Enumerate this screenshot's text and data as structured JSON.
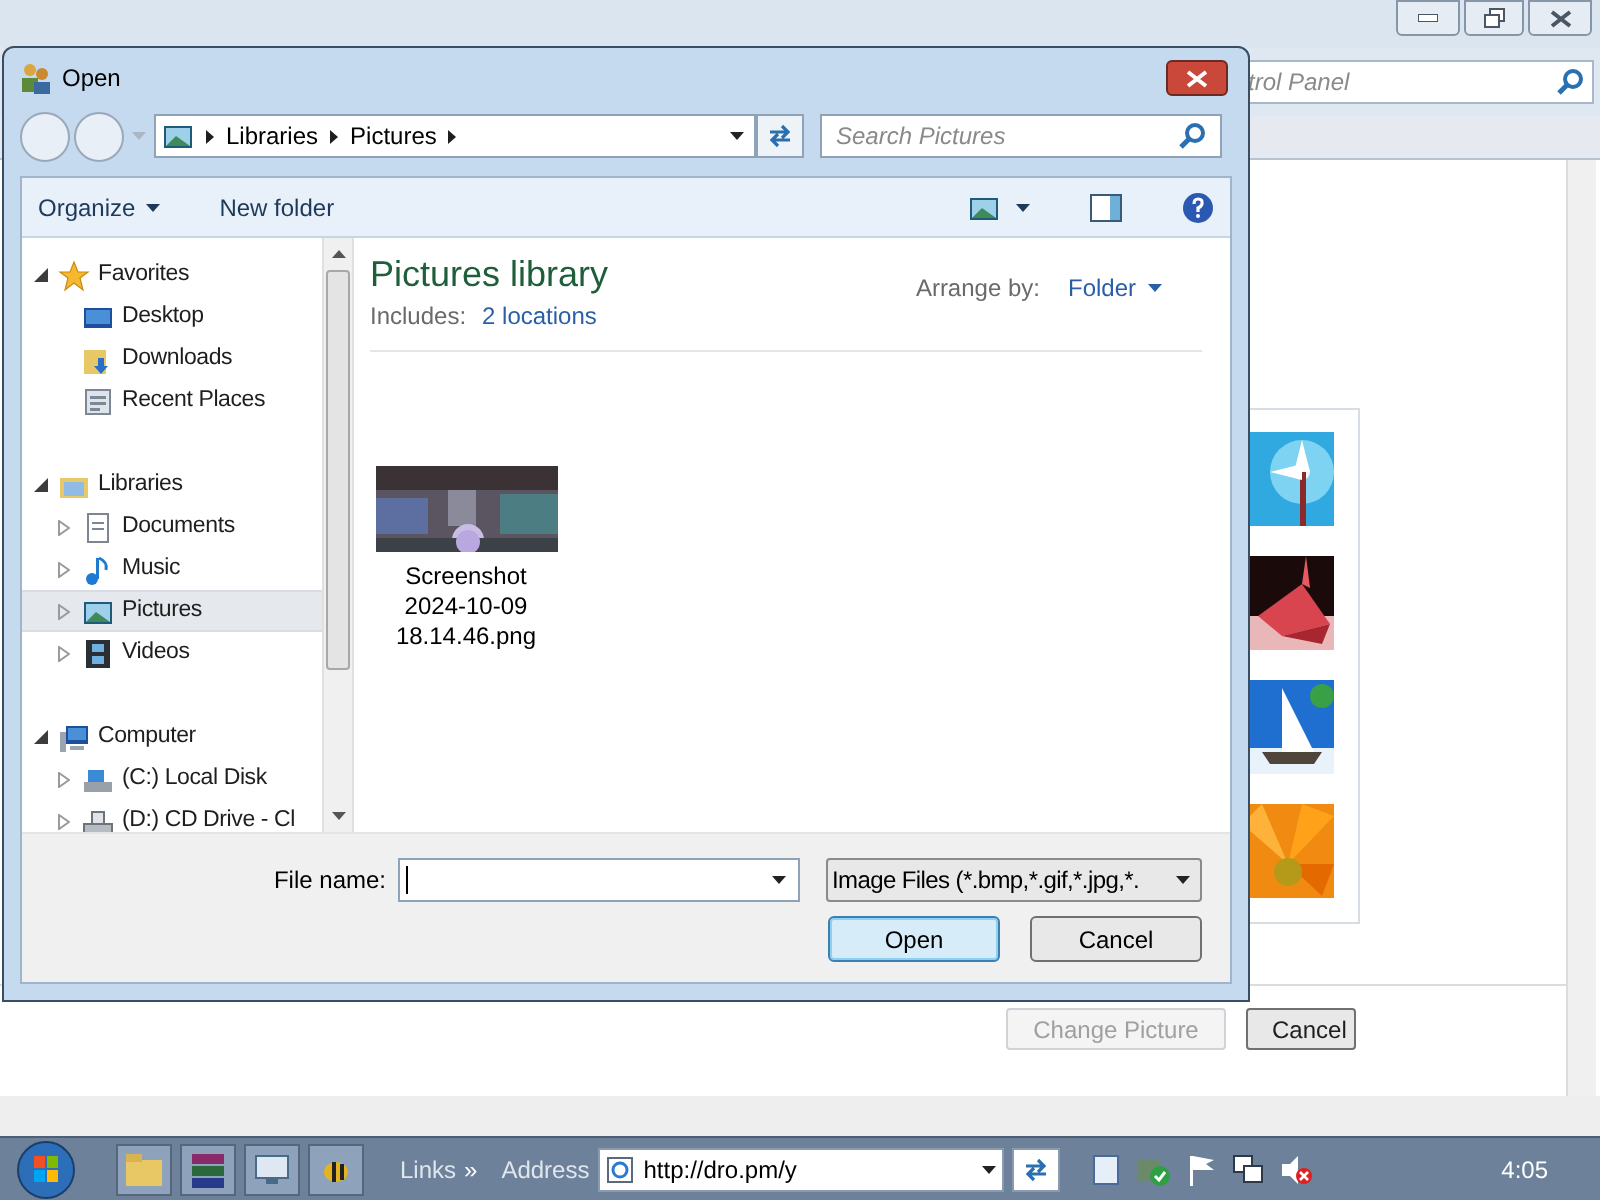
{
  "background_window": {
    "search": {
      "placeholder": "trol Panel"
    },
    "buttons": [
      {
        "label": "Change Picture",
        "disabled": true
      },
      {
        "label": "Cancel",
        "disabled": false
      }
    ]
  },
  "dialog": {
    "title": "Open",
    "breadcrumb": [
      "Libraries",
      "Pictures"
    ],
    "search": {
      "placeholder": "Search Pictures"
    },
    "toolbar": {
      "organize": "Organize",
      "new_folder": "New folder"
    },
    "nav_tree": [
      {
        "label": "Favorites",
        "expanded": true,
        "selected": false,
        "children": [
          {
            "label": "Desktop",
            "selected": false
          },
          {
            "label": "Downloads",
            "selected": false
          },
          {
            "label": "Recent Places",
            "selected": false
          }
        ]
      },
      {
        "label": "Libraries",
        "expanded": true,
        "selected": false,
        "children": [
          {
            "label": "Documents",
            "expanded": false,
            "selected": false
          },
          {
            "label": "Music",
            "expanded": false,
            "selected": false
          },
          {
            "label": "Pictures",
            "expanded": false,
            "selected": true
          },
          {
            "label": "Videos",
            "expanded": false,
            "selected": false
          }
        ]
      },
      {
        "label": "Computer",
        "expanded": true,
        "selected": false,
        "children": [
          {
            "label": "(C:) Local Disk",
            "expanded": false,
            "selected": false
          },
          {
            "label": "(D:) CD Drive - Cl",
            "expanded": false,
            "selected": false
          }
        ]
      }
    ],
    "library": {
      "title": "Pictures library",
      "includes_label": "Includes:",
      "includes_link": "2 locations",
      "arrange_label": "Arrange by:",
      "arrange_value": "Folder"
    },
    "files": [
      {
        "name": "Screenshot 2024-10-09 18.14.46.png"
      }
    ],
    "file_name": {
      "label": "File name:"
    },
    "file_type": "Image Files (*.bmp,*.gif,*.jpg,*.",
    "buttons": [
      {
        "label": "Open",
        "default": true
      },
      {
        "label": "Cancel",
        "default": false
      }
    ]
  },
  "taskbar": {
    "links": "Links",
    "chevron": "»",
    "address_label": "Address",
    "address": "http://dro.pm/y",
    "clock": "4:05"
  }
}
